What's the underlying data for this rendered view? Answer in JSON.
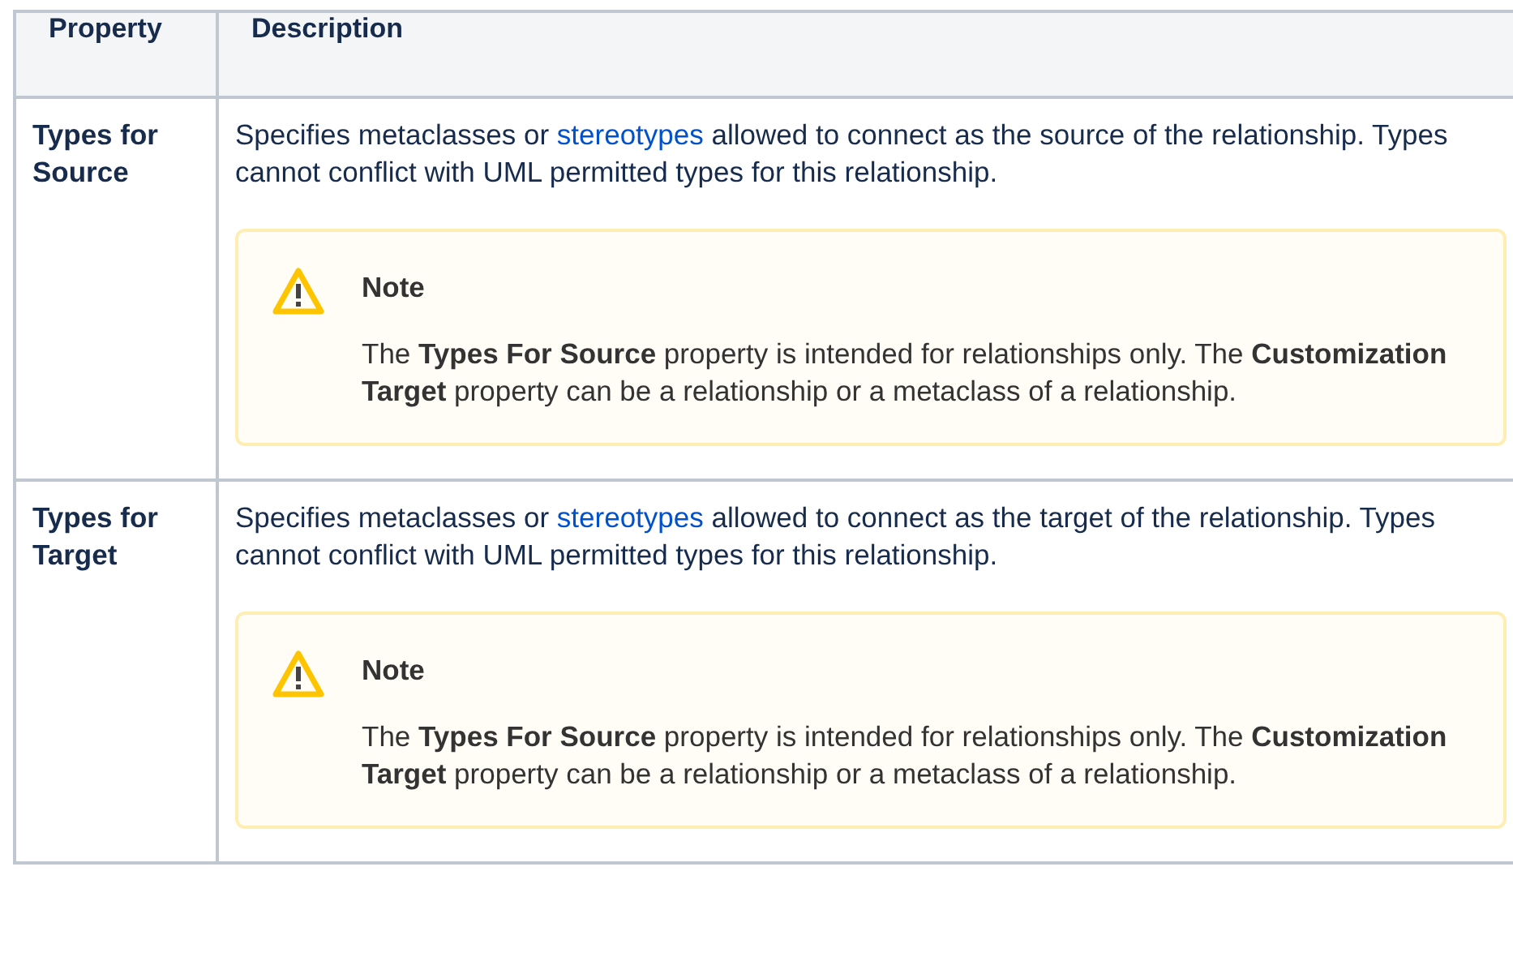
{
  "table": {
    "columns": [
      "Property",
      "Description"
    ],
    "rows": [
      {
        "property": "Types for Source",
        "description_before": "Specifies metaclasses or ",
        "description_link": "stereotypes",
        "description_after": " allowed to connect as the source of the relationship. Types cannot conflict with UML permitted types for this relationship.",
        "note": {
          "title": "Note",
          "body": "The **Types For Source** property is intended for relationships only. The **Customization Target** property can be a relationship or a metaclass of a relationship."
        }
      },
      {
        "property": "Types for Target",
        "description_before": "Specifies metaclasses or ",
        "description_link": "stereotypes",
        "description_after": " allowed to connect as the target of the relationship. Types cannot conflict with UML permitted types for this relationship.",
        "note": {
          "title": "Note",
          "body": "The **Types For Source** property is intended for relationships only. The **Customization Target** property can be a relationship or a metaclass of a relationship."
        }
      }
    ]
  }
}
